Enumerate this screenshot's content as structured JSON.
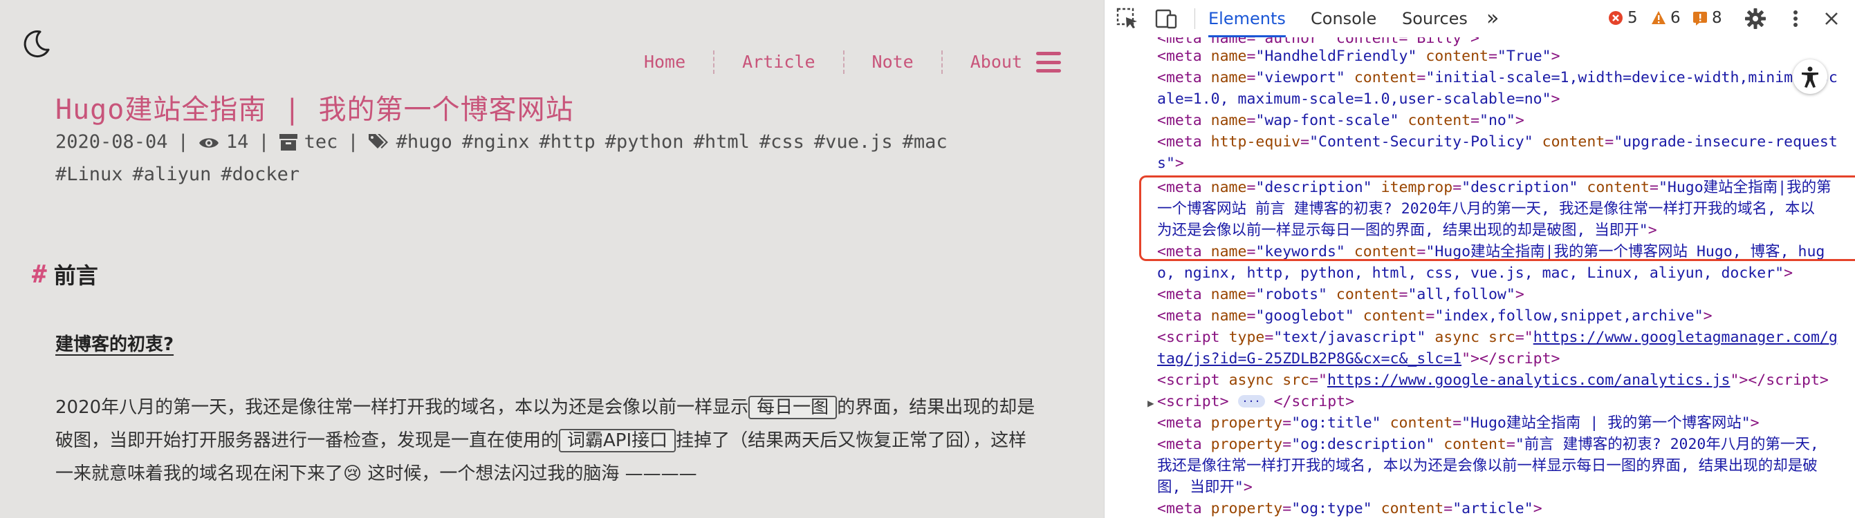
{
  "blog": {
    "nav": [
      "Home",
      "Article",
      "Note",
      "About"
    ],
    "title": "Hugo建站全指南 | 我的第一个博客网站",
    "meta": {
      "date": "2020-08-04",
      "views": "14",
      "category": "tec",
      "tags": [
        "#hugo",
        "#nginx",
        "#http",
        "#python",
        "#html",
        "#css",
        "#vue.js",
        "#mac",
        "#Linux",
        "#aliyun",
        "#docker"
      ]
    },
    "section_heading": "前言",
    "sub_heading": "建博客的初衷?",
    "paragraph": {
      "p1": "2020年八月的第一天，我还是像往常一样打开我的域名，本以为还是会像以前一样显示",
      "chip1": "每日一图",
      "p2": "的界面，结果出现的却是破图，当即开始打开服务器进行一番检查，发现是一直在使用的",
      "chip2": "词霸API接口",
      "p3": "挂掉了（结果两天后又恢复正常了囧），这样一来就意味着我的域名现在闲下来了😢 这时候，一个想法闪过我的脑海 ————"
    }
  },
  "devtools": {
    "tabs": [
      "Elements",
      "Console",
      "Sources"
    ],
    "active_tab": "Elements",
    "more_tabs": "»",
    "errors": "5",
    "warnings": "6",
    "issues": "8",
    "code": {
      "l0_a": "<meta name=\"author\" content=\"Billy\">",
      "l1_name": "\"HandheldFriendly\"",
      "l1_content": "\"True\"",
      "l2_name": "\"viewport\"",
      "l2_content": "\"initial-scale=1,width=device-width,minimum-sc",
      "l3": "ale=1.0, maximum-scale=1.0,user-scalable=no\"",
      "l4_name": "\"wap-font-scale\"",
      "l4_content": "\"no\"",
      "l5_equiv": "\"Content-Security-Policy\"",
      "l5_content": "\"upgrade-insecure-request",
      "l6": "s\"",
      "l7_name": "\"description\"",
      "l7_itemprop": "\"description\"",
      "l7_content": "\"Hugo建站全指南|我的第",
      "l8": "一个博客网站 前言 建博客的初衷? 2020年八月的第一天, 我还是像往常一样打开我的域名, 本以",
      "l9": "为还是会像以前一样显示每日一图的界面, 结果出现的却是破图, 当即开\"",
      "l10_name": "\"keywords\"",
      "l10_content": "\"Hugo建站全指南|我的第一个博客网站 Hugo, 博客, hug",
      "l11": "o, nginx, http, python, html, css, vue.js, mac, Linux, aliyun, docker\"",
      "l12_name": "\"robots\"",
      "l12_content": "\"all,follow\"",
      "l13_name": "\"googlebot\"",
      "l13_content": "\"index,follow,snippet,archive\"",
      "l14_type": "\"text/javascript\"",
      "l14_src": "https://www.googletagmanager.com/g",
      "l15_src": "tag/js?id=G-25ZDLB2P8G&cx=c&_slc=1",
      "l16_src": "https://www.google-analytics.com/analytics.js",
      "l17_ellipsis": "···",
      "l18_prop": "\"og:title\"",
      "l18_content": "\"Hugo建站全指南 | 我的第一个博客网站\"",
      "l19_prop": "\"og:description\"",
      "l19_content": "\"前言 建博客的初衷? 2020年八月的第一天,",
      "l20": "我还是像往常一样打开我的域名, 本以为还是会像以前一样显示每日一图的界面, 结果出现的却是破",
      "l21": "图, 当即开\"",
      "l22_prop": "\"og:type\"",
      "l22_content": "\"article\""
    }
  },
  "colors": {
    "accent_pink": "#c8547a",
    "highlight_red": "#e5432a",
    "devtools_blue": "#1a56d6"
  }
}
